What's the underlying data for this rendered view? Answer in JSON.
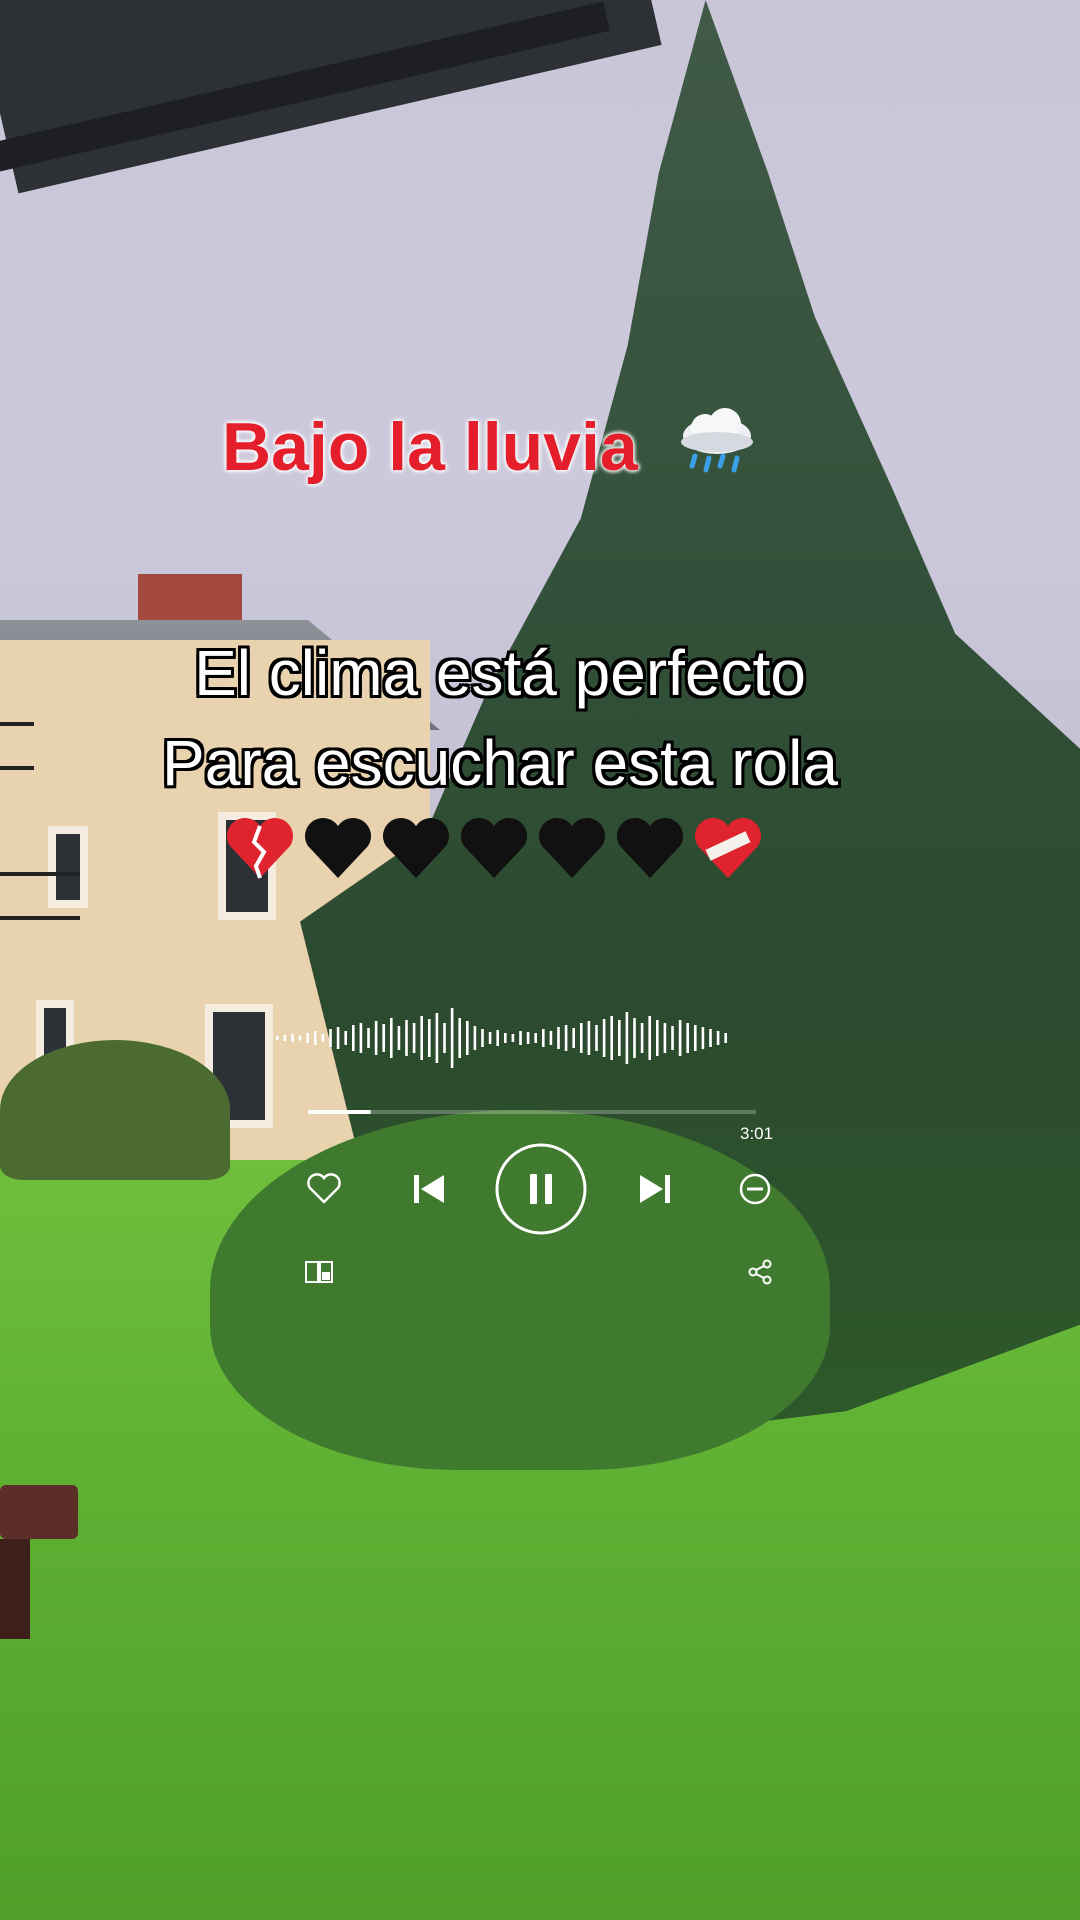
{
  "title": {
    "text": "Bajo  la lluvia",
    "emoji": "cloud-with-rain-icon"
  },
  "lyrics": [
    "El clima está perfecto",
    "Para escuchar esta rola"
  ],
  "hearts": [
    "broken-heart-icon",
    "black-heart-icon",
    "black-heart-icon",
    "black-heart-icon",
    "black-heart-icon",
    "black-heart-icon",
    "mending-heart-icon"
  ],
  "player": {
    "total_time": "3:01",
    "progress": 0.14,
    "state": "playing"
  },
  "colors": {
    "title": "#e41f2b",
    "lyrics": "#ffffff",
    "controls": "#ffffff"
  }
}
